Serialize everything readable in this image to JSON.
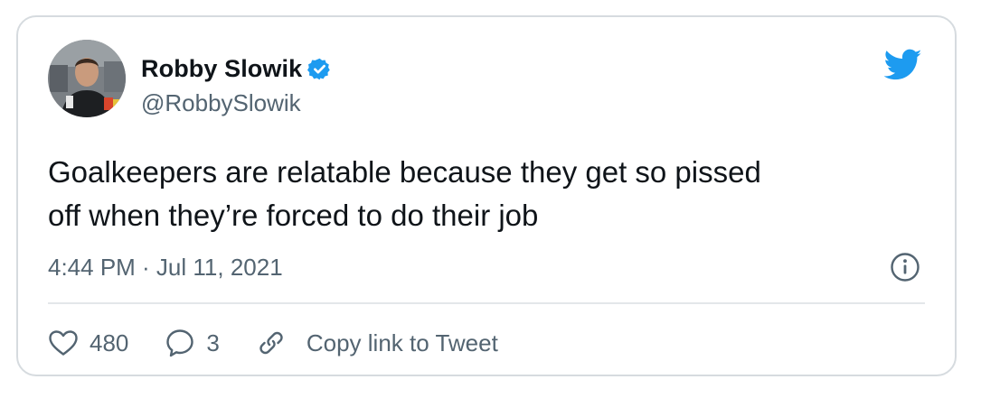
{
  "tweet": {
    "author": {
      "name": "Robby Slowik",
      "handle": "@RobbySlowik",
      "verified": true
    },
    "text_lines": [
      "Goalkeepers are relatable because they get so pissed",
      "off when they’re forced to do their job"
    ],
    "timestamp": "4:44 PM · Jul 11, 2021",
    "actions": {
      "like_count": "480",
      "reply_count": "3",
      "copy_link_label": "Copy link to Tweet"
    }
  },
  "icons": [
    "twitter-logo-icon",
    "verified-badge-icon",
    "info-icon",
    "heart-icon",
    "reply-bubble-icon",
    "link-icon"
  ],
  "colors": {
    "brand_blue": "#1d9bf0",
    "text_primary": "#0f1419",
    "text_secondary": "#536471",
    "border": "#d6dbdf"
  }
}
